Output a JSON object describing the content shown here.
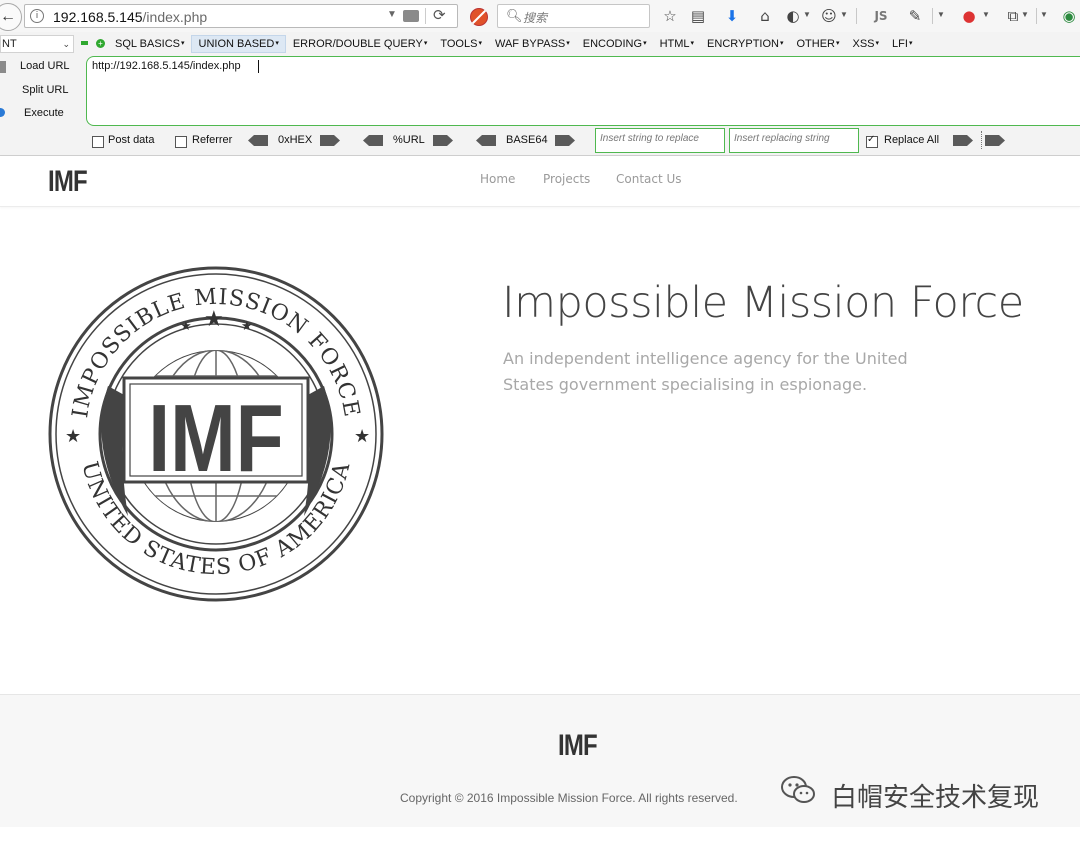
{
  "browser": {
    "url_host": "192.168.5.145",
    "url_path": "/index.php",
    "search_placeholder": "搜索",
    "toolbar_icons": [
      "back-icon",
      "info-icon",
      "reader-icon",
      "reload-icon",
      "noscript-icon",
      "search-icon",
      "bookmark-star-icon",
      "reading-list-icon",
      "download-icon",
      "home-icon",
      "addon-icon",
      "palette-icon",
      "js-icon",
      "plugin-icon",
      "record-icon",
      "container-icon",
      "chrome-icon"
    ],
    "js_label": "JS"
  },
  "hackbar": {
    "select_value": "NT",
    "menu": [
      "SQL BASICS",
      "UNION BASED",
      "ERROR/DOUBLE QUERY",
      "TOOLS",
      "WAF BYPASS",
      "ENCODING",
      "HTML",
      "ENCRYPTION",
      "OTHER",
      "XSS",
      "LFI"
    ],
    "active_menu": "UNION BASED",
    "actions": {
      "load": "Load URL",
      "split": "Split URL",
      "execute": "Execute"
    },
    "textarea_value": "http://192.168.5.145/index.php",
    "options": {
      "post_data": "Post data",
      "referrer": "Referrer",
      "hex": "0xHEX",
      "url": "%URL",
      "base64": "BASE64",
      "replace_placeholder": "Insert string to replace",
      "replacing_placeholder": "Insert replacing string",
      "replace_all": "Replace All"
    },
    "checked": {
      "post_data": false,
      "referrer": false,
      "replace_all": true
    }
  },
  "site": {
    "logo": "IMF",
    "nav": [
      "Home",
      "Projects",
      "Contact Us"
    ],
    "hero_title": "Impossible Mission Force",
    "hero_subtitle": "An independent intelligence agency for the United States government specialising in espionage.",
    "seal": {
      "top_text": "IMPOSSIBLE MISSION FORCE",
      "bottom_text": "UNITED STATES OF AMERICA",
      "center": "IMF"
    },
    "copyright": "Copyright © 2016 Impossible Mission Force. All rights reserved.",
    "watermark": "白帽安全技术复现"
  },
  "colors": {
    "accent_green": "#4fb84f",
    "text_dark": "#444444",
    "text_muted": "#a8a8a8"
  }
}
